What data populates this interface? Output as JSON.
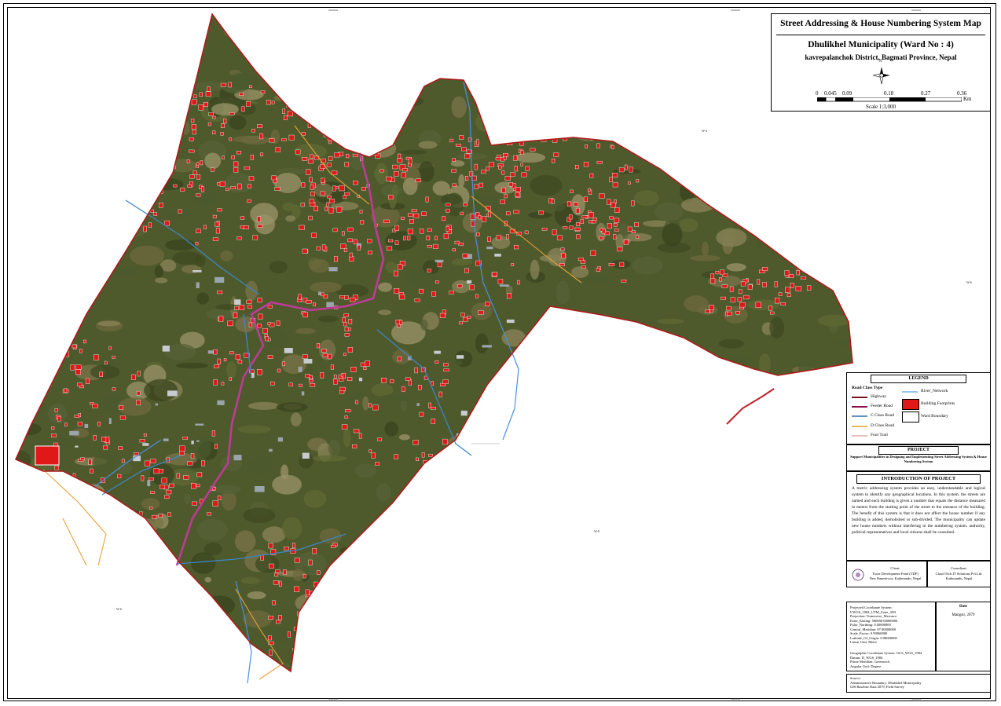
{
  "title": "Street Addressing & House Numbering System Map",
  "subtitle": "Dhulikhel Municipality (Ward No : 4)",
  "location": "kavrepalanchok District, Bagmati Province, Nepal",
  "north_arrow_label": "N",
  "scale_bar": {
    "labels": [
      "0",
      "0.045",
      "0.09",
      "0.18",
      "0.27",
      "0.36"
    ],
    "unit": "Km",
    "scale_text": "Scale 1:3,000"
  },
  "grid_ticks": {
    "top": [
      "xxxxxx",
      "xxxxxx",
      "xxxxxx"
    ],
    "bottom": [
      "xxxxxx",
      "xxxxxx",
      "xxxxxx"
    ],
    "left": [
      "xxxxxxx",
      "xxxxxxx",
      "xxxxxxx"
    ],
    "right": [
      "xxxxxxx",
      "xxxxxxx",
      "xxxxxxx"
    ]
  },
  "map_labels": [
    "W-4",
    "W-6",
    "W-8",
    "W-6"
  ],
  "legend": {
    "title": "LEGEND",
    "road_class_title": "Road Class Type",
    "roads": [
      {
        "label": "Highway",
        "color": "#7a1420"
      },
      {
        "label": "Feeder Road",
        "color": "#8b1050"
      },
      {
        "label": "C Class Road",
        "color": "#2d6ea8"
      },
      {
        "label": "D Class Road",
        "color": "#e0a030"
      },
      {
        "label": "Foot Trail",
        "color": "#d08080"
      }
    ],
    "river": {
      "label": "River_Network",
      "color": "#5aa0e8"
    },
    "building": {
      "label": "Building Footprints",
      "color": "#e01818"
    },
    "ward": {
      "label": "Ward Boundary"
    }
  },
  "project": {
    "title": "PROJECT",
    "text": "Support Municipalities in Designing and Implementing Street Addressing System & House Numbering System"
  },
  "intro": {
    "title": "INTRODUCTION OF PROJECT",
    "text": "A metric addressing system provides an easy, understandable and logical system to identify any geographical locations. In this system, the streets are named and each building is given a number that equals the distance measured in meters from the starting point of the street to the entrance of the building. The benefit of this system is that it does not affect the house number if any building is added, demolished or sub-divided. The municipality can update new house numbers without interfering in the numbering system. authority, political representatives and local citizens shall be consulted."
  },
  "client": {
    "title": "Client:",
    "name": "Town Development Fund (TDF)",
    "address": "New Baneshwor, Kathmandu, Nepal"
  },
  "consultant": {
    "title": "Consultant:",
    "name": "Cloud Tech IT Solutions Pvt.Ltd.",
    "address": "Kathmandu, Nepal"
  },
  "projection": [
    "Projected Coordinate System: UWGS_1984_UTM_Zone_45N",
    "Projection: Transverse_Mercator",
    "False_Easting: 500000.00000000",
    "False_Northing: 0.00000000",
    "Central_Meridian: 87.00000000",
    "Scale_Factor: 0.99960000",
    "Latitude_Of_Origin: 0.00000000",
    "Linear Unit: Meter"
  ],
  "geographic": [
    "Geographic Coordinate System: GCS_WGS_1984",
    "Datum: D_WGS_1984",
    "Prime Meridian: Greenwich",
    "Angular Unit: Degree"
  ],
  "date": {
    "title": "Date",
    "value": "Mangsir, 2079"
  },
  "source": {
    "title": "Source:",
    "lines": [
      "Administrative Boundary: Dhulikhel Municipality",
      "GIS Baseline Data 2079, Field Survey"
    ]
  }
}
